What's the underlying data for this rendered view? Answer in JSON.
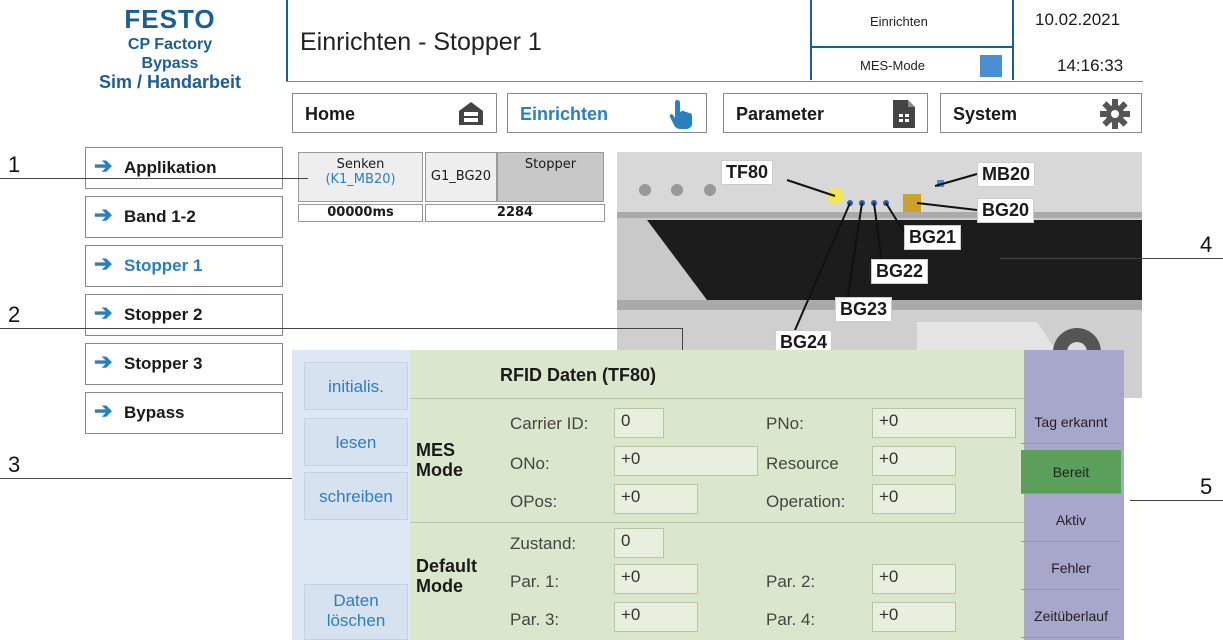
{
  "brand": {
    "logo": "FESTO",
    "line1": "CP Factory",
    "line2": "Bypass",
    "line3": "Sim / Handarbeit"
  },
  "header": {
    "title": "Einrichten - Stopper 1",
    "mode": "Einrichten",
    "mes_mode": "MES-Mode",
    "date": "10.02.2021",
    "time": "14:16:33"
  },
  "nav": {
    "home": "Home",
    "einrichten": "Einrichten",
    "parameter": "Parameter",
    "system": "System"
  },
  "sidebar": {
    "items": [
      {
        "label": "Applikation"
      },
      {
        "label": "Band 1-2"
      },
      {
        "label": "Stopper 1"
      },
      {
        "label": "Stopper 2"
      },
      {
        "label": "Stopper 3"
      },
      {
        "label": "Bypass"
      }
    ]
  },
  "callouts": [
    "1",
    "2",
    "3",
    "4",
    "5"
  ],
  "io": {
    "senken": "Senken",
    "senken_sub": "(K1_MB20)",
    "g1": "G1_BG20",
    "stopper": "Stopper",
    "timer": "00000ms",
    "count": "2284"
  },
  "image_labels": {
    "tf80": "TF80",
    "mb20": "MB20",
    "bg20": "BG20",
    "bg21": "BG21",
    "bg22": "BG22",
    "bg23": "BG23",
    "bg24": "BG24"
  },
  "rfid_buttons": {
    "init": "initialis.",
    "read": "lesen",
    "write": "schreiben",
    "clear1": "Daten",
    "clear2": "löschen"
  },
  "rfid": {
    "title": "RFID Daten (TF80)",
    "mes_mode_1": "MES",
    "mes_mode_2": "Mode",
    "default_mode_1": "Default",
    "default_mode_2": "Mode",
    "carrier_id_label": "Carrier ID:",
    "carrier_id": "0",
    "pno_label": "PNo:",
    "pno": "+0",
    "ono_label": "ONo:",
    "ono": "+0",
    "resource_label": "Resource",
    "resource": "+0",
    "opos_label": "OPos:",
    "opos": "+0",
    "operation_label": "Operation:",
    "operation": "+0",
    "zustand_label": "Zustand:",
    "zustand": "0",
    "par1_label": "Par. 1:",
    "par1": "+0",
    "par2_label": "Par. 2:",
    "par2": "+0",
    "par3_label": "Par. 3:",
    "par3": "+0",
    "par4_label": "Par. 4:",
    "par4": "+0"
  },
  "status": {
    "tag": "Tag erkannt",
    "ready": "Bereit",
    "active": "Aktiv",
    "error": "Fehler",
    "timeout": "Zeitüberlauf",
    "ready_color": "#5aa05a"
  },
  "colors": {
    "brand": "#1b5e96",
    "accent": "#2a7fc1",
    "rfid_bg": "#dbe7cc",
    "status_bg": "#a7a6cb"
  }
}
